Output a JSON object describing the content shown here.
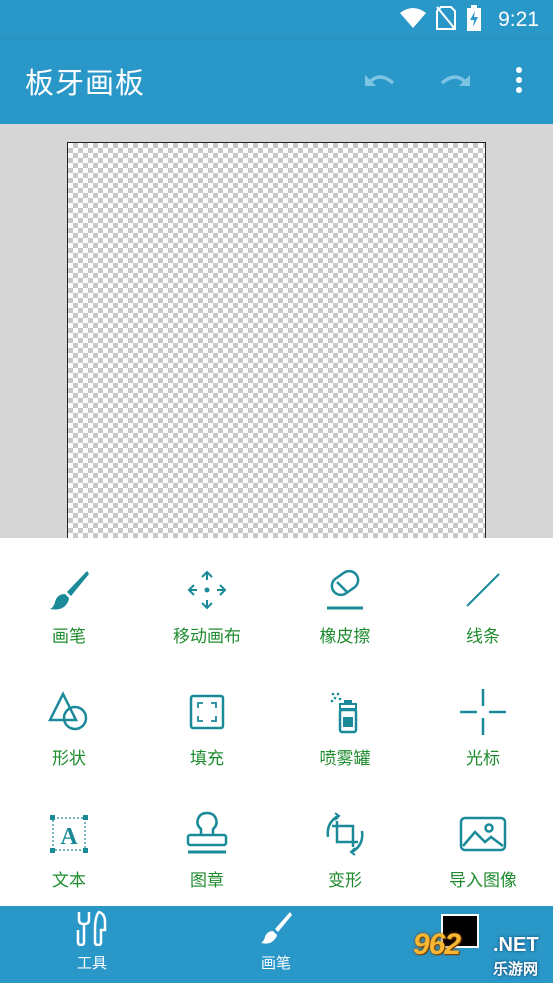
{
  "status_bar": {
    "time": "9:21"
  },
  "app_bar": {
    "title": "板牙画板"
  },
  "tools": [
    {
      "label": "画笔",
      "icon": "brush-icon"
    },
    {
      "label": "移动画布",
      "icon": "move-canvas-icon"
    },
    {
      "label": "橡皮擦",
      "icon": "eraser-icon"
    },
    {
      "label": "线条",
      "icon": "line-icon"
    },
    {
      "label": "形状",
      "icon": "shapes-icon"
    },
    {
      "label": "填充",
      "icon": "fill-icon"
    },
    {
      "label": "喷雾罐",
      "icon": "spray-can-icon"
    },
    {
      "label": "光标",
      "icon": "crosshair-icon"
    },
    {
      "label": "文本",
      "icon": "text-icon"
    },
    {
      "label": "图章",
      "icon": "stamp-icon"
    },
    {
      "label": "变形",
      "icon": "transform-icon"
    },
    {
      "label": "导入图像",
      "icon": "import-image-icon"
    }
  ],
  "bottom_nav": {
    "tools_label": "工具",
    "brush_label": "画笔",
    "current_color": "#000000"
  },
  "watermark": {
    "logo": "962",
    "net": ".NET",
    "sub": "乐游网"
  },
  "colors": {
    "primary": "#2a97c9",
    "accent": "#1e8c2e",
    "icon": "#1a8a99"
  }
}
